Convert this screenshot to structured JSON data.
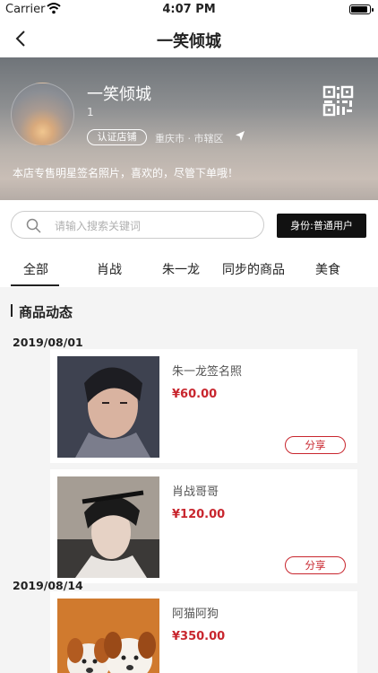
{
  "status_bar": {
    "carrier": "Carrier",
    "time": "4:07 PM"
  },
  "navbar": {
    "title": "一笑倾城"
  },
  "shop": {
    "name": "一笑倾城",
    "number": "1",
    "cert_label": "认证店铺",
    "location": "重庆市 · 市辖区",
    "description": "本店专售明星签名照片，喜欢的，尽管下单哦！"
  },
  "search": {
    "placeholder": "请输入搜索关键词",
    "identity_label": "身份:普通用户"
  },
  "tabs": [
    "全部",
    "肖战",
    "朱一龙",
    "同步的商品",
    "美食"
  ],
  "active_tab": 0,
  "section_title": "商品动态",
  "groups": [
    {
      "date": "2019/08/01",
      "items": [
        {
          "title": "朱一龙签名照",
          "price": "¥60.00",
          "share_label": "分享",
          "image": "portrait-zhu"
        },
        {
          "title": "肖战哥哥",
          "price": "¥120.00",
          "share_label": "分享",
          "image": "portrait-xiao"
        }
      ]
    },
    {
      "date": "2019/08/14",
      "items": [
        {
          "title": "阿猫阿狗",
          "price": "¥350.00",
          "share_label": "分享",
          "image": "puppies"
        }
      ]
    }
  ],
  "colors": {
    "accent_red": "#c8262e",
    "dark": "#111111"
  }
}
